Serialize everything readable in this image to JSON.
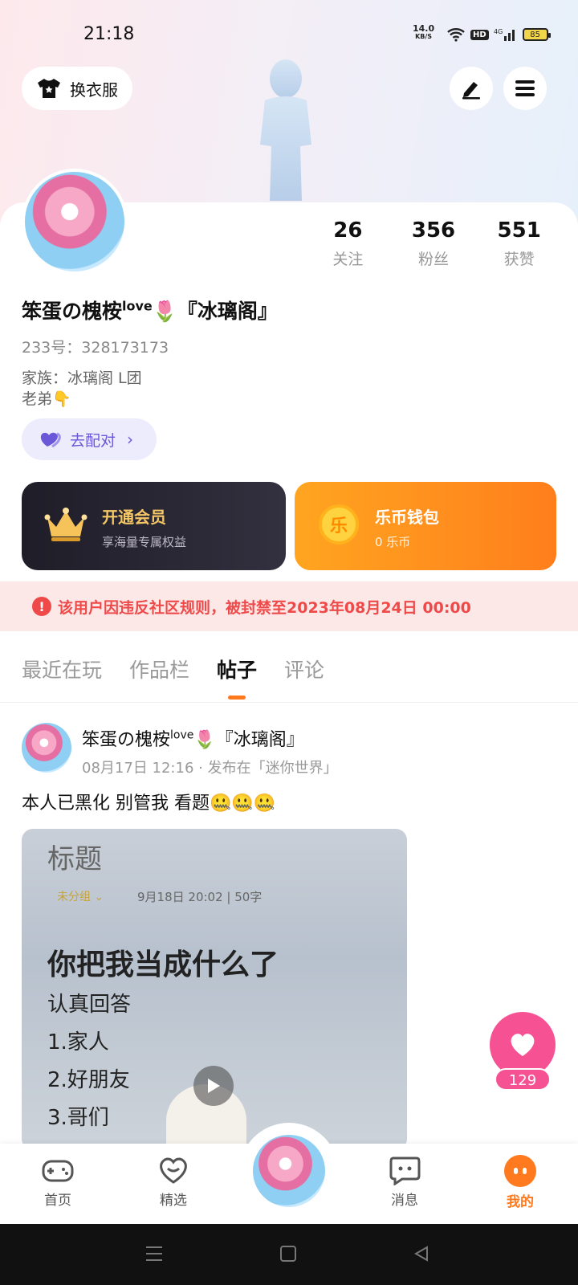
{
  "status_bar": {
    "time": "21:18",
    "net_speed": "14.0",
    "net_unit": "KB/S",
    "hd": "HD",
    "battery": "85"
  },
  "header": {
    "outfit_label": "换衣服"
  },
  "profile": {
    "stats": [
      {
        "value": "26",
        "label": "关注"
      },
      {
        "value": "356",
        "label": "粉丝"
      },
      {
        "value": "551",
        "label": "获赞"
      }
    ],
    "nickname_prefix": "笨蛋の槐桉",
    "nickname_sup": "love",
    "nickname_suffix": "🌷『冰璃阁』",
    "uid": "233号：328173173",
    "family": "家族：冰璃阁 L团",
    "bio": "老弟👇",
    "match_label": "去配对"
  },
  "promos": {
    "vip": {
      "title": "开通会员",
      "subtitle": "享海量专属权益"
    },
    "wallet": {
      "title": "乐币钱包",
      "subtitle": "0 乐币",
      "coin_glyph": "乐"
    }
  },
  "ban_notice": "该用户因违反社区规则，被封禁至2023年08月24日 00:00",
  "tabs": [
    "最近在玩",
    "作品栏",
    "帖子",
    "评论"
  ],
  "post": {
    "author_prefix": "笨蛋の槐桉",
    "author_sup": "love",
    "author_suffix": "🌷『冰璃阁』",
    "meta": "08月17日 12:16 · 发布在「迷你世界」",
    "text": "本人已黑化 别管我 看题🤐🤐🤐",
    "image": {
      "title": "标题",
      "tag": "未分组 ⌄",
      "date": "9月18日 20:02 | 50字",
      "headline": "你把我当成什么了",
      "lines": [
        "认真回答",
        "1.家人",
        "2.好朋友",
        "3.哥们"
      ]
    }
  },
  "like": {
    "count": "129"
  },
  "bottom_nav": [
    {
      "label": "首页"
    },
    {
      "label": "精选"
    },
    {
      "label": "消息"
    },
    {
      "label": "我的"
    }
  ],
  "colors": {
    "accent": "#ff7a1e",
    "ban": "#ef4a4a",
    "like": "#f55193"
  }
}
